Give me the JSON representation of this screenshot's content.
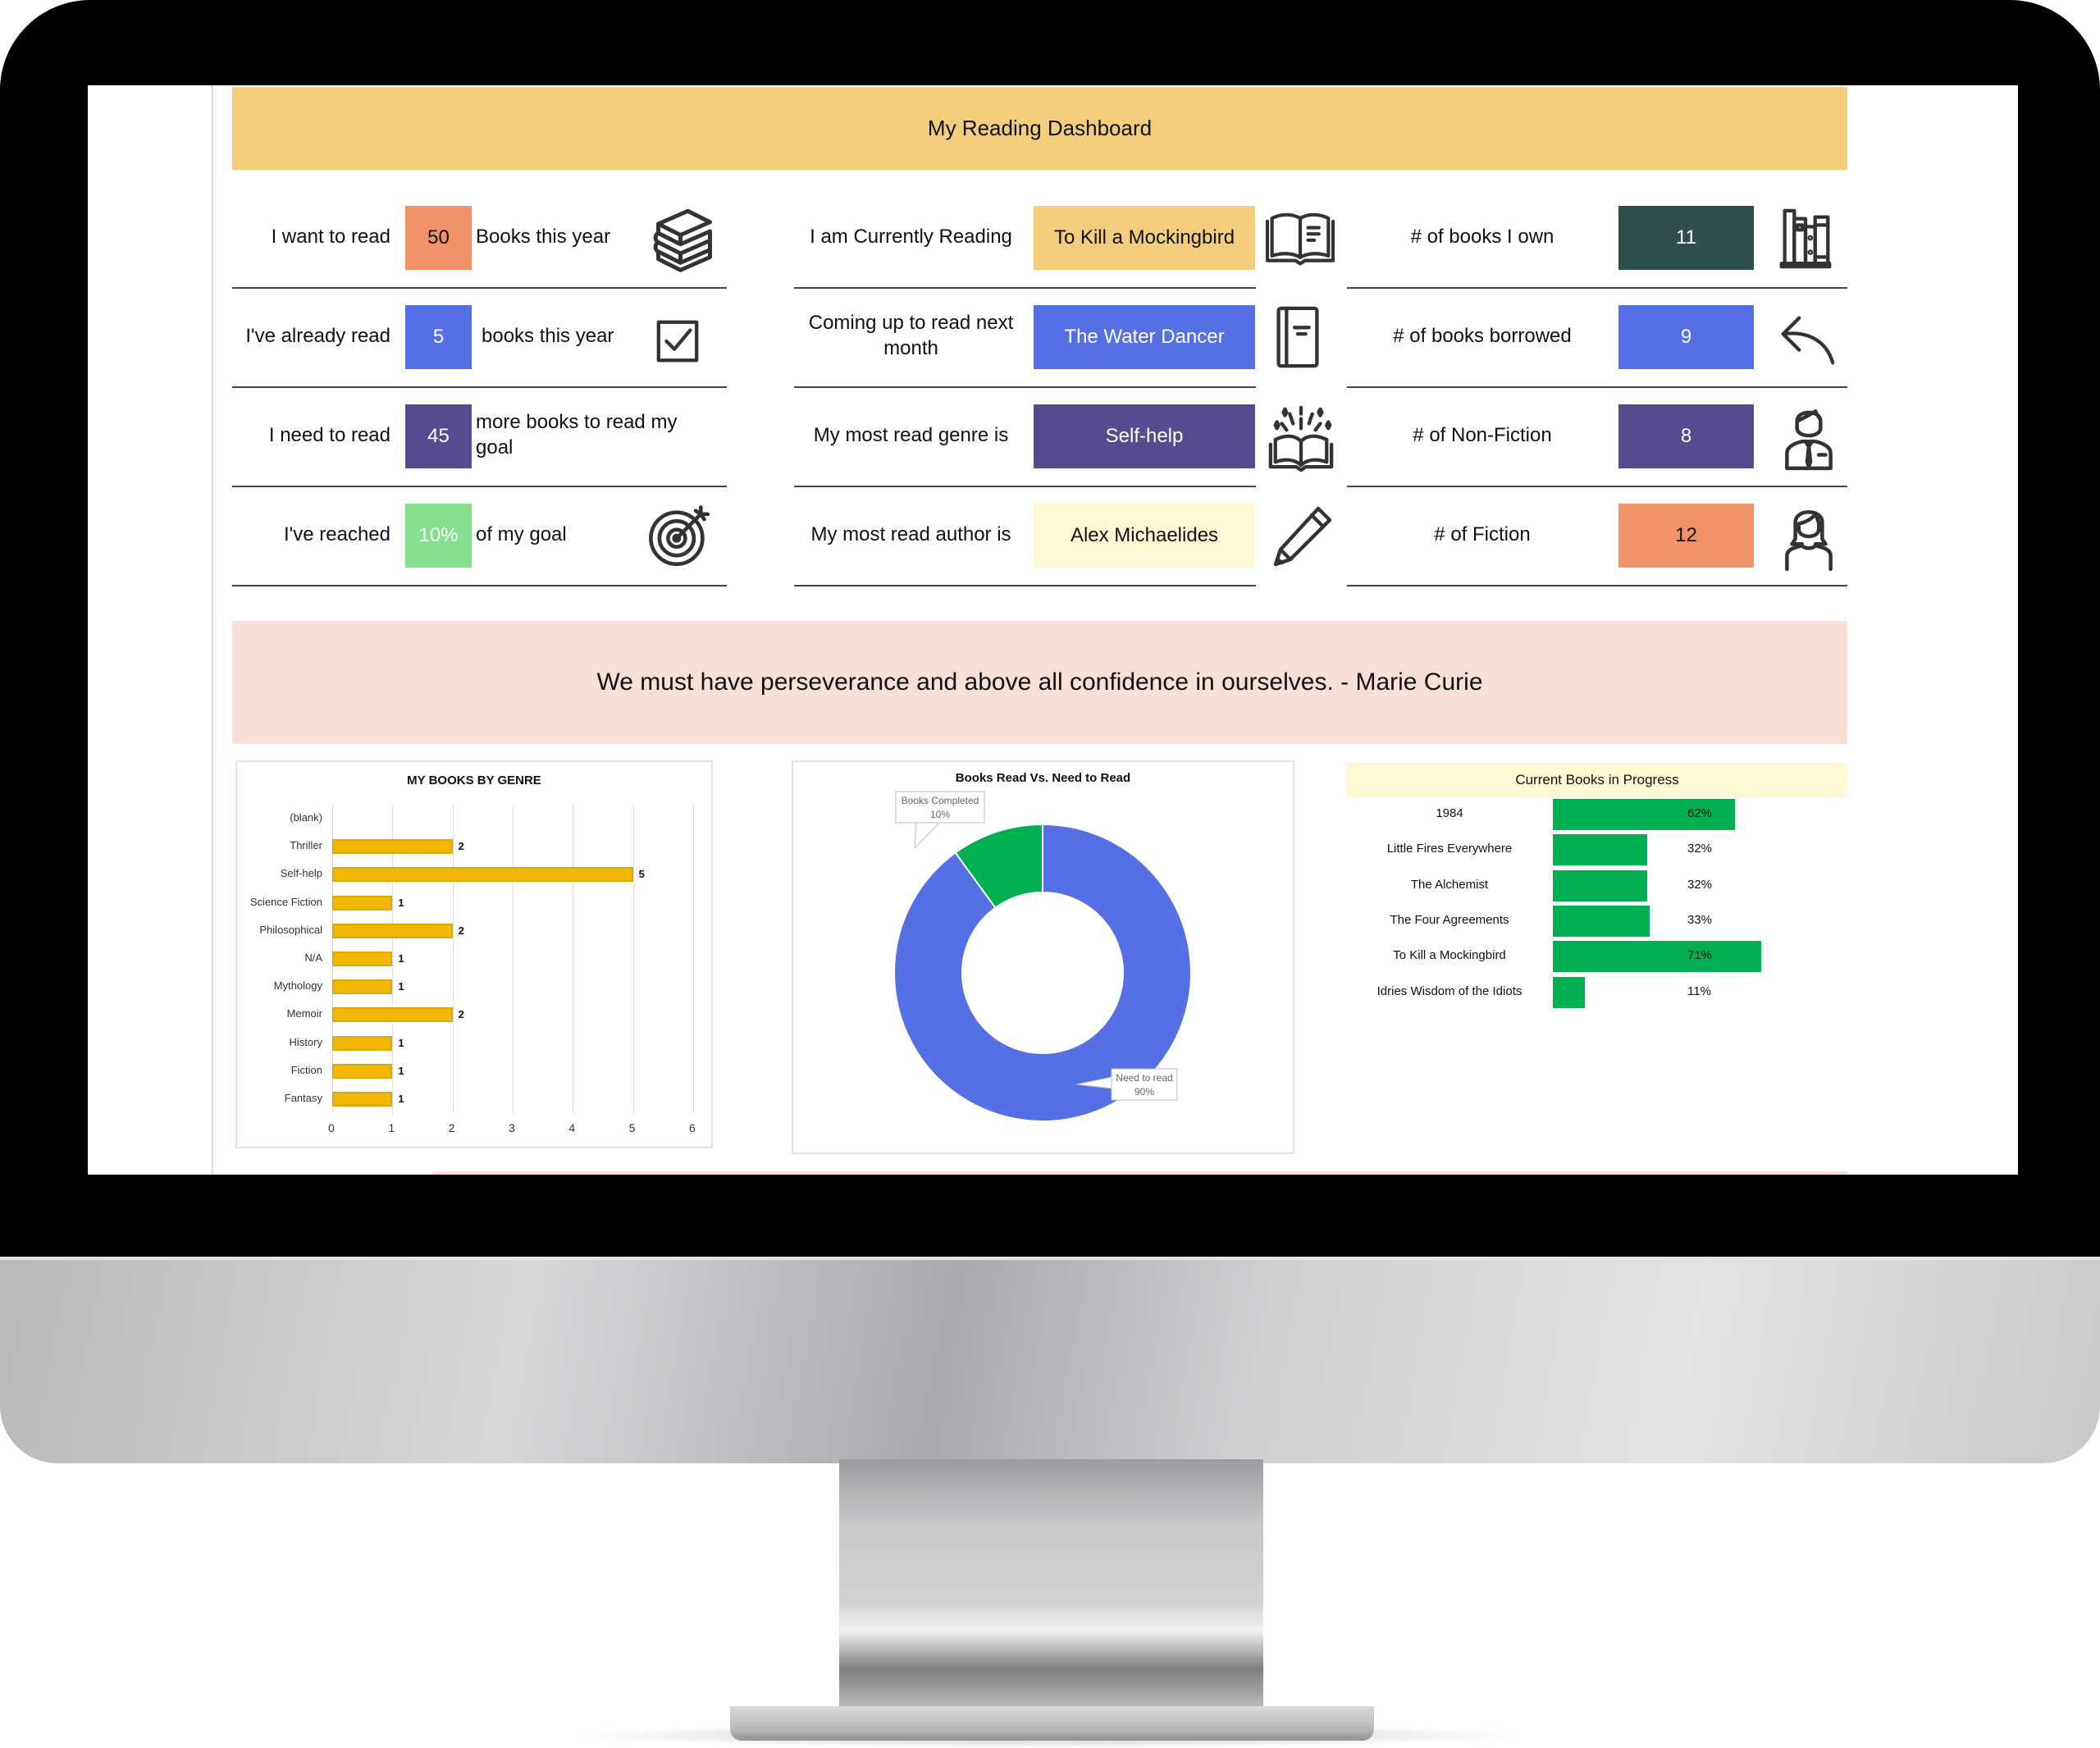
{
  "dashboard": {
    "title": "My Reading Dashboard",
    "quote": "We must have perseverance and above all confidence in ourselves. - Marie Curie"
  },
  "goals": [
    {
      "label": "I want to read",
      "value": "50",
      "suffix": "Books this year",
      "icon": "books-stack-icon",
      "color": "#F0926A",
      "text_color": "#111111"
    },
    {
      "label": "I've already read",
      "value": "5",
      "suffix": "books this year",
      "icon": "checkbox-checked-icon",
      "color": "#5570E4",
      "text_color": "#ffffff"
    },
    {
      "label": "I need to read",
      "value": "45",
      "suffix": "more books to read my goal",
      "icon": "",
      "color": "#564B8E",
      "text_color": "#ffffff"
    },
    {
      "label": "I've reached",
      "value": "10%",
      "suffix": "of my goal",
      "icon": "target-icon",
      "color": "#86E18E",
      "text_color": "#ffffff"
    }
  ],
  "reading": [
    {
      "label": "I am Currently Reading",
      "value": "To Kill a Mockingbird",
      "icon": "open-book-icon",
      "color": "#F3CD7B",
      "text_color": "#111111"
    },
    {
      "label": "Coming up to read next month",
      "value": "The Water Dancer",
      "icon": "notebook-icon",
      "color": "#5570E4",
      "text_color": "#ffffff"
    },
    {
      "label": "My most read genre is",
      "value": "Self-help",
      "icon": "magic-book-icon",
      "color": "#564B8E",
      "text_color": "#ffffff"
    },
    {
      "label": "My most read author is",
      "value": "Alex Michaelides",
      "icon": "pencil-icon",
      "color": "#FEF8D3",
      "text_color": "#111111"
    }
  ],
  "counts": [
    {
      "label": "# of books I own",
      "value": "11",
      "icon": "bookshelf-icon",
      "color": "#2F4F4F",
      "text_color": "#ffffff"
    },
    {
      "label": "# of books borrowed",
      "value": "9",
      "icon": "return-arrow-icon",
      "color": "#5570E4",
      "text_color": "#ffffff"
    },
    {
      "label": "# of Non-Fiction",
      "value": "8",
      "icon": "businessman-icon",
      "color": "#564B8E",
      "text_color": "#ffffff"
    },
    {
      "label": "# of Fiction",
      "value": "12",
      "icon": "woman-icon",
      "color": "#F0926A",
      "text_color": "#111111"
    }
  ],
  "chart_data": [
    {
      "type": "bar",
      "orientation": "horizontal",
      "title": "MY BOOKS  BY GENRE",
      "categories": [
        "(blank)",
        "Thriller",
        "Self-help",
        "Science Fiction",
        "Philosophical",
        "N/A",
        "Mythology",
        "Memoir",
        "History",
        "Fiction",
        "Fantasy"
      ],
      "values": [
        null,
        2,
        5,
        1,
        2,
        1,
        1,
        2,
        1,
        1,
        1
      ],
      "xlim": [
        0,
        6
      ],
      "xticks": [
        "0",
        "1",
        "2",
        "3",
        "4",
        "5",
        "6"
      ],
      "grid": true,
      "bar_color": "#F2B800",
      "xlabel": "",
      "ylabel": ""
    },
    {
      "type": "pie",
      "variant": "donut",
      "title": "Books Read Vs. Need to Read",
      "slices": [
        {
          "label": "Books Completed",
          "value": 10,
          "display": "10%",
          "color": "#00AF50"
        },
        {
          "label": "Need to read",
          "value": 90,
          "display": "90%",
          "color": "#5570E4"
        }
      ]
    },
    {
      "type": "bar",
      "orientation": "horizontal",
      "title": "Current Books in Progress",
      "categories": [
        "1984",
        "Little Fires Everywhere",
        "The Alchemist",
        "The Four Agreements",
        "To Kill a Mockingbird",
        "Idries Wisdom of the Idiots"
      ],
      "values": [
        0.62,
        0.32,
        0.32,
        0.33,
        0.71,
        0.11
      ],
      "labels": [
        "62%",
        "32%",
        "32%",
        "33%",
        "71%",
        "11%"
      ],
      "bar_color": "#00AF50",
      "xlim": [
        0,
        1
      ]
    }
  ]
}
